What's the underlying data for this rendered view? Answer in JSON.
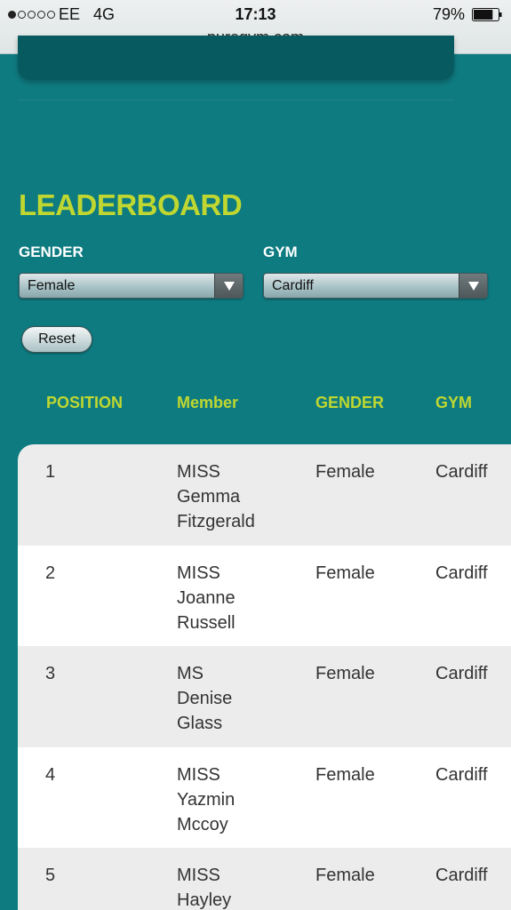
{
  "status_bar": {
    "carrier": "EE",
    "network": "4G",
    "time": "17:13",
    "battery_percent": "79%",
    "battery_level": 0.79,
    "signal_bars_filled": 1,
    "signal_bars_total": 5,
    "url": "puregym.com"
  },
  "leaderboard": {
    "title": "LEADERBOARD",
    "filters": {
      "gender_label": "GENDER",
      "gender_value": "Female",
      "gym_label": "GYM",
      "gym_value": "Cardiff"
    },
    "reset_label": "Reset",
    "columns": {
      "position": "POSITION",
      "member": "Member",
      "gender": "GENDER",
      "gym": "GYM"
    },
    "rows": [
      {
        "position": "1",
        "title": "MISS",
        "first": "Gemma",
        "last": "Fitzgerald",
        "gender": "Female",
        "gym": "Cardiff"
      },
      {
        "position": "2",
        "title": "MISS",
        "first": "Joanne",
        "last": "Russell",
        "gender": "Female",
        "gym": "Cardiff"
      },
      {
        "position": "3",
        "title": "MS",
        "first": "Denise",
        "last": "Glass",
        "gender": "Female",
        "gym": "Cardiff"
      },
      {
        "position": "4",
        "title": "MISS",
        "first": "Yazmin",
        "last": "Mccoy",
        "gender": "Female",
        "gym": "Cardiff"
      },
      {
        "position": "5",
        "title": "MISS",
        "first": "Hayley",
        "last": "",
        "gender": "Female",
        "gym": "Cardiff"
      }
    ]
  },
  "colors": {
    "page_background": "#0e7b80",
    "accent": "#bfd730",
    "row_shaded": "#ececec",
    "row_plain": "#ffffff"
  }
}
